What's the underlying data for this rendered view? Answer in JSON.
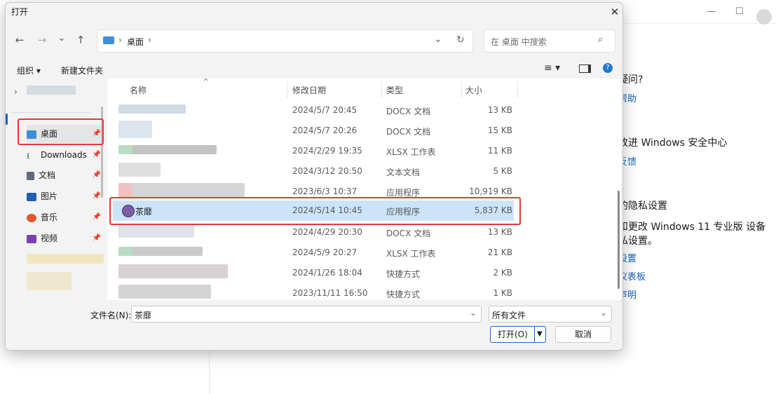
{
  "background_window": {
    "title_buttons": [
      "—",
      "☐"
    ],
    "text1": "疑问?",
    "link1": "帮助",
    "text2": "改进 Windows 安全中心",
    "link2": "反馈",
    "text3": "的隐私设置",
    "text4": "和更改 Windows 11 专业版 设备",
    "text5": "私设置。",
    "link3": "设置",
    "link4": "仪表板",
    "link5": "声明"
  },
  "dialog": {
    "title": "打开",
    "close": "✕",
    "nav": {
      "back": "←",
      "forward": "→",
      "down": "⌄",
      "up": "↑"
    },
    "address": {
      "segments": [
        "桌面"
      ],
      "sep": "›"
    },
    "search": {
      "placeholder": "在 桌面 中搜索"
    },
    "toolbar": {
      "organize": "组织 ▾",
      "new_folder": "新建文件夹"
    },
    "sidebar": {
      "items": [
        {
          "label": "桌面",
          "icon": "desktop-icon",
          "color": "#3c8fd6"
        },
        {
          "label": "Downloads",
          "icon": "download-icon",
          "color": "#2e7d32"
        },
        {
          "label": "文档",
          "icon": "document-icon",
          "color": "#5f6b7a"
        },
        {
          "label": "图片",
          "icon": "picture-icon",
          "color": "#1e5fb3"
        },
        {
          "label": "音乐",
          "icon": "music-icon",
          "color": "#e2572b"
        },
        {
          "label": "视频",
          "icon": "video-icon",
          "color": "#7b3fb0"
        }
      ]
    },
    "columns": {
      "name": "名称",
      "date": "修改日期",
      "type": "类型",
      "size": "大小"
    },
    "files": [
      {
        "name": "",
        "date": "2024/5/7 20:45",
        "type": "DOCX 文档",
        "size": "13 KB"
      },
      {
        "name": "",
        "date": "2024/5/7 20:26",
        "type": "DOCX 文档",
        "size": "15 KB"
      },
      {
        "name": "",
        "date": "2024/2/29 19:35",
        "type": "XLSX 工作表",
        "size": "11 KB"
      },
      {
        "name": "",
        "date": "2024/3/12 20:50",
        "type": "文本文档",
        "size": "5 KB"
      },
      {
        "name": "",
        "date": "2023/6/3 10:37",
        "type": "应用程序",
        "size": "10,919 KB"
      },
      {
        "name": "茶靡",
        "date": "2024/5/14 10:45",
        "type": "应用程序",
        "size": "5,837 KB"
      },
      {
        "name": "",
        "date": "2024/4/29 20:30",
        "type": "DOCX 文档",
        "size": "13 KB"
      },
      {
        "name": "",
        "date": "2024/5/9 20:27",
        "type": "XLSX 工作表",
        "size": "21 KB"
      },
      {
        "name": "",
        "date": "2024/1/26 18:04",
        "type": "快捷方式",
        "size": "2 KB"
      },
      {
        "name": "",
        "date": "2023/11/11 16:50",
        "type": "快捷方式",
        "size": "1 KB"
      }
    ],
    "filename_label": "文件名(N):",
    "filename_value": "茶靡",
    "filetype_value": "所有文件",
    "open_button": "打开(O)",
    "cancel_button": "取消"
  }
}
